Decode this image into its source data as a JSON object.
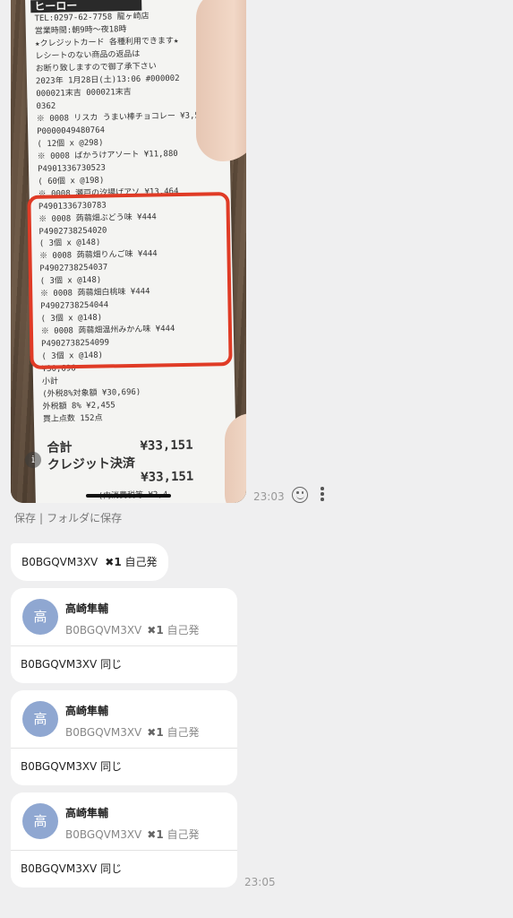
{
  "receipt_photo": {
    "logo": "ヒーロー",
    "lines": [
      "TEL:0297-62-7758        龍ヶ崎店",
      "営業時間:朝9時〜夜18時",
      "★クレジットカード 各種利用できます★",
      "レシートのない商品の返品は",
      "お断り致しますので御了承下さい",
      "2023年 1月28日(土)13:06 #000002",
      "000021末吉        000021末吉",
      "                        0362",
      "※ 0008 リスカ うまい棒チョコレー ¥3,576",
      "      P0000049480764",
      "    ( 12個 x @298)",
      "※ 0008 ばかうけアソート ¥11,880",
      "      P4901336730523",
      "    ( 60個 x @198)",
      "※ 0008 瀬戸の汐揚げアソ ¥13,464",
      "      P4901336730783",
      "※ 0008 蒟蒻畑ぶどう味      ¥444",
      "      P4902738254020",
      "    (  3個 x @148)",
      "※ 0008 蒟蒻畑りんご味      ¥444",
      "      P4902738254037",
      "    (  3個 x @148)",
      "※ 0008 蒟蒻畑白桃味        ¥444",
      "      P4902738254044",
      "    (  3個 x @148)",
      "※ 0008 蒟蒻畑温州みかん味  ¥444",
      "      P4902738254099",
      "    (  3個 x @148)",
      "                      ¥30,696",
      "小計",
      "(外税8%対象額          ¥30,696)",
      " 外税額      8%       ¥2,455",
      " 買上点数               152点"
    ],
    "total_label": "合計",
    "total_value": "¥33,151",
    "credit_label": "クレジット決済",
    "credit_value": "¥33,151",
    "tax_note": "(内消費税等       ¥2,4"
  },
  "photo_time": "23:03",
  "save_actions": {
    "save": "保存",
    "separator": "|",
    "save_folder": "フォルダに保存"
  },
  "message1": {
    "code": "B0BGQVM3XV",
    "mark": "✖1",
    "note": "自己発"
  },
  "replies": [
    {
      "avatar": "高",
      "name": "高崎隼輔",
      "quote_code": "B0BGQVM3XV",
      "quote_mark": "✖1",
      "quote_note": "自己発",
      "reply_code": "B0BGQVM3XV",
      "reply_note": "同じ"
    },
    {
      "avatar": "高",
      "name": "高崎隼輔",
      "quote_code": "B0BGQVM3XV",
      "quote_mark": "✖1",
      "quote_note": "自己発",
      "reply_code": "B0BGQVM3XV",
      "reply_note": "同じ"
    },
    {
      "avatar": "高",
      "name": "高崎隼輔",
      "quote_code": "B0BGQVM3XV",
      "quote_mark": "✖1",
      "quote_note": "自己発",
      "reply_code": "B0BGQVM3XV",
      "reply_note": "同じ"
    }
  ],
  "last_time": "23:05",
  "icons": {
    "reaction": "smile-icon",
    "more": "more-vertical-icon",
    "info": "info-icon"
  }
}
